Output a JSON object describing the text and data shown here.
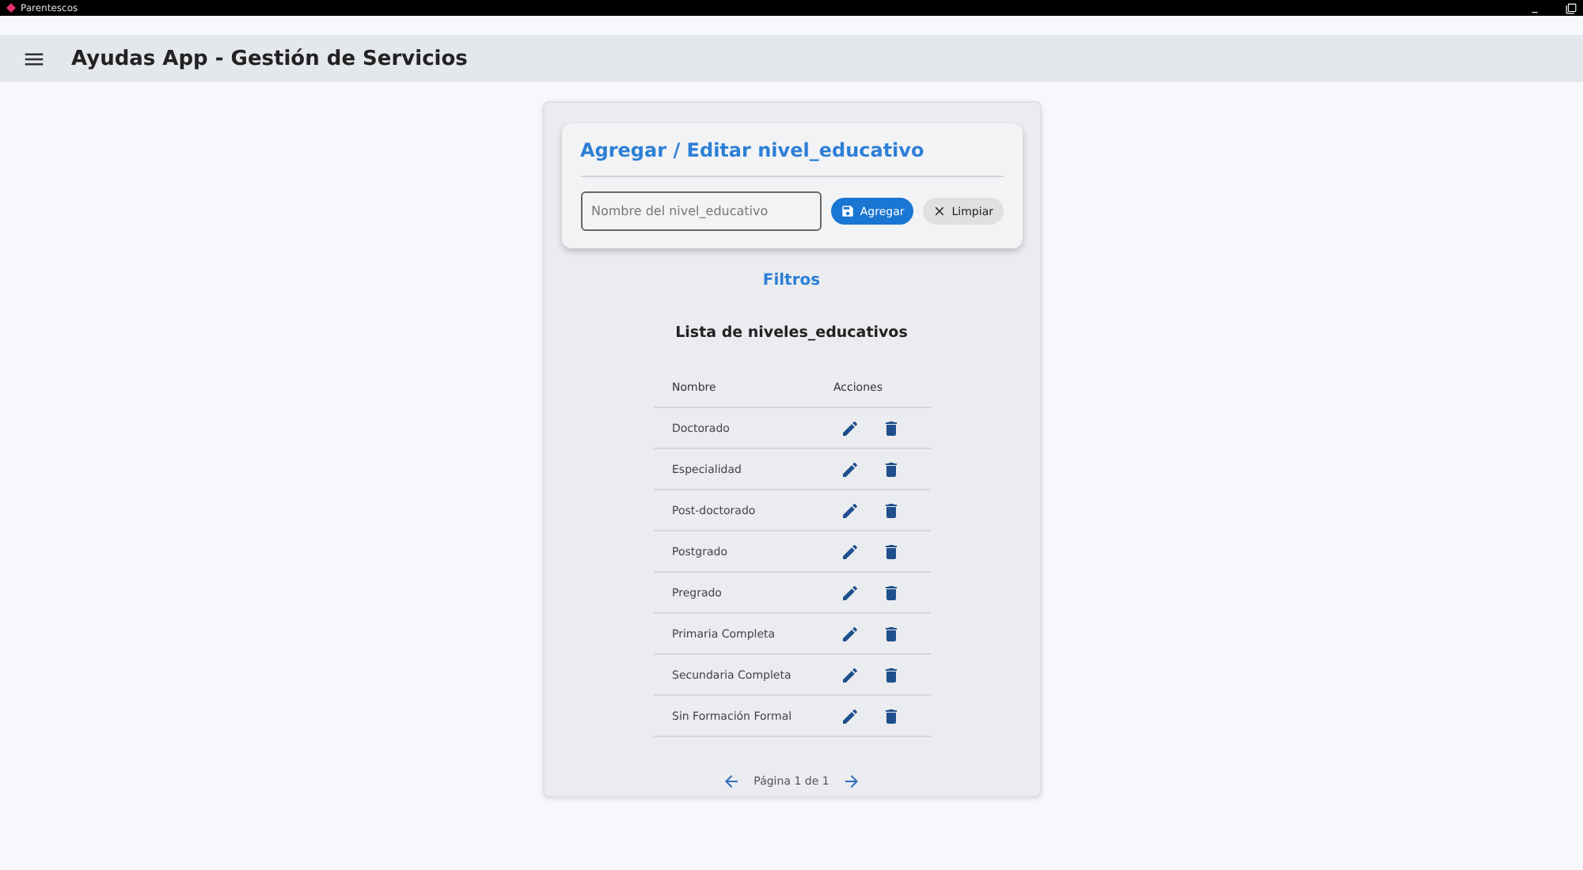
{
  "window": {
    "title": "Parentescos"
  },
  "app_bar": {
    "title": "Ayudas App - Gestión de Servicios"
  },
  "form": {
    "title": "Agregar / Editar nivel_educativo",
    "input": {
      "placeholder": "Nombre del nivel_educativo"
    },
    "buttons": [
      {
        "kind": "primary",
        "label": "Agregar"
      },
      {
        "kind": "secondary",
        "label": "Limpiar"
      }
    ]
  },
  "filters": {
    "label": "Filtros"
  },
  "list": {
    "title": "Lista de niveles_educativos",
    "columns": [
      "Nombre",
      "Acciones"
    ],
    "rows": [
      {
        "name": "Doctorado"
      },
      {
        "name": "Especialidad"
      },
      {
        "name": "Post-doctorado"
      },
      {
        "name": "Postgrado"
      },
      {
        "name": "Pregrado"
      },
      {
        "name": "Primaria Completa"
      },
      {
        "name": "Secundaria Completa"
      },
      {
        "name": "Sin Formación Formal"
      }
    ]
  },
  "pagination": {
    "label": "Página 1 de 1"
  }
}
